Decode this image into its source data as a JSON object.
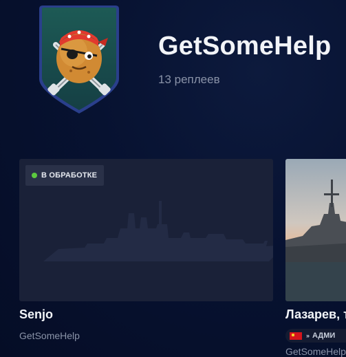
{
  "clan": {
    "name": "GetSomeHelp",
    "replays_count": "13 реплеев"
  },
  "replays": [
    {
      "status": "В ОБРАБОТКЕ",
      "title": "Senjo",
      "author": "GetSomeHelp"
    },
    {
      "title": "Лазарев, т",
      "tag": "АДМИ",
      "author": "GetSomeHelp"
    }
  ],
  "colors": {
    "background": "#071231",
    "card": "#1a2138",
    "status_dot": "#5cc93f",
    "muted_text": "#8a93a8"
  },
  "icons": [
    "clan-emblem-icon",
    "ship-silhouette-icon",
    "flag-icon",
    "rank-chevrons-icon"
  ]
}
